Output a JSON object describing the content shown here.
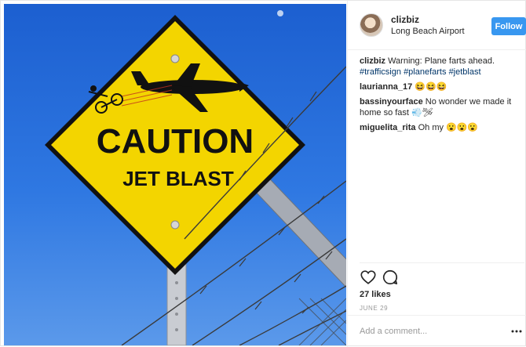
{
  "header": {
    "username": "clizbiz",
    "location": "Long Beach Airport",
    "follow_label": "Follow",
    "accent": "#3897f0"
  },
  "photo": {
    "sign_line1": "CAUTION",
    "sign_line2": "JET BLAST",
    "sign_color": "#f3d500"
  },
  "comments": [
    {
      "author": "clizbiz",
      "text": "Warning: Plane farts ahead. ",
      "tags": [
        "#trafficsign",
        "#planefarts",
        "#jetblast"
      ]
    },
    {
      "author": "laurianna_17",
      "text": "😆😆😆"
    },
    {
      "author": "bassinyourface",
      "text": "No wonder we made it home so fast 💨🛩"
    },
    {
      "author": "miguelita_rita",
      "text": "Oh my 😮😮😮"
    }
  ],
  "actions": {
    "icons": [
      "heart-icon",
      "comment-icon"
    ],
    "likes": "27 likes",
    "date": "JUNE 29"
  },
  "add_comment": {
    "placeholder": "Add a comment..."
  }
}
